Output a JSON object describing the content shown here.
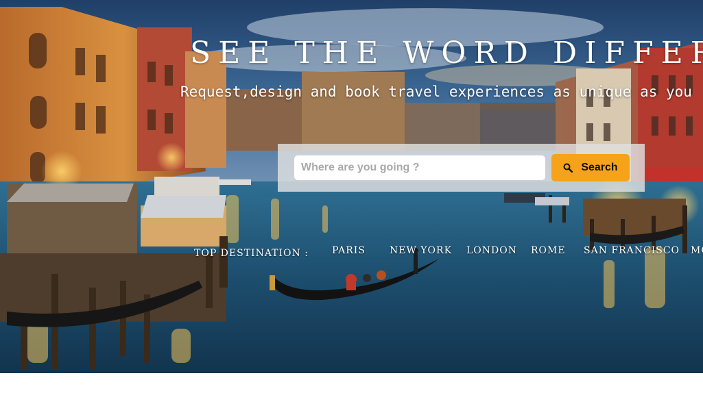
{
  "hero": {
    "headline": "SEE THE WORD DIFFERENTLY",
    "subline": "Request,design and book travel experiences as unique as you"
  },
  "search": {
    "placeholder": "Where are you going ?",
    "value": "",
    "button_label": "Search",
    "button_icon": "search-icon",
    "button_color": "#f7a21b"
  },
  "destinations": {
    "label": "TOP DESTINATION :",
    "items": [
      "PARIS",
      "NEW YORK",
      "LONDON",
      "ROME",
      "SAN FRANCISCO",
      "MO"
    ]
  }
}
